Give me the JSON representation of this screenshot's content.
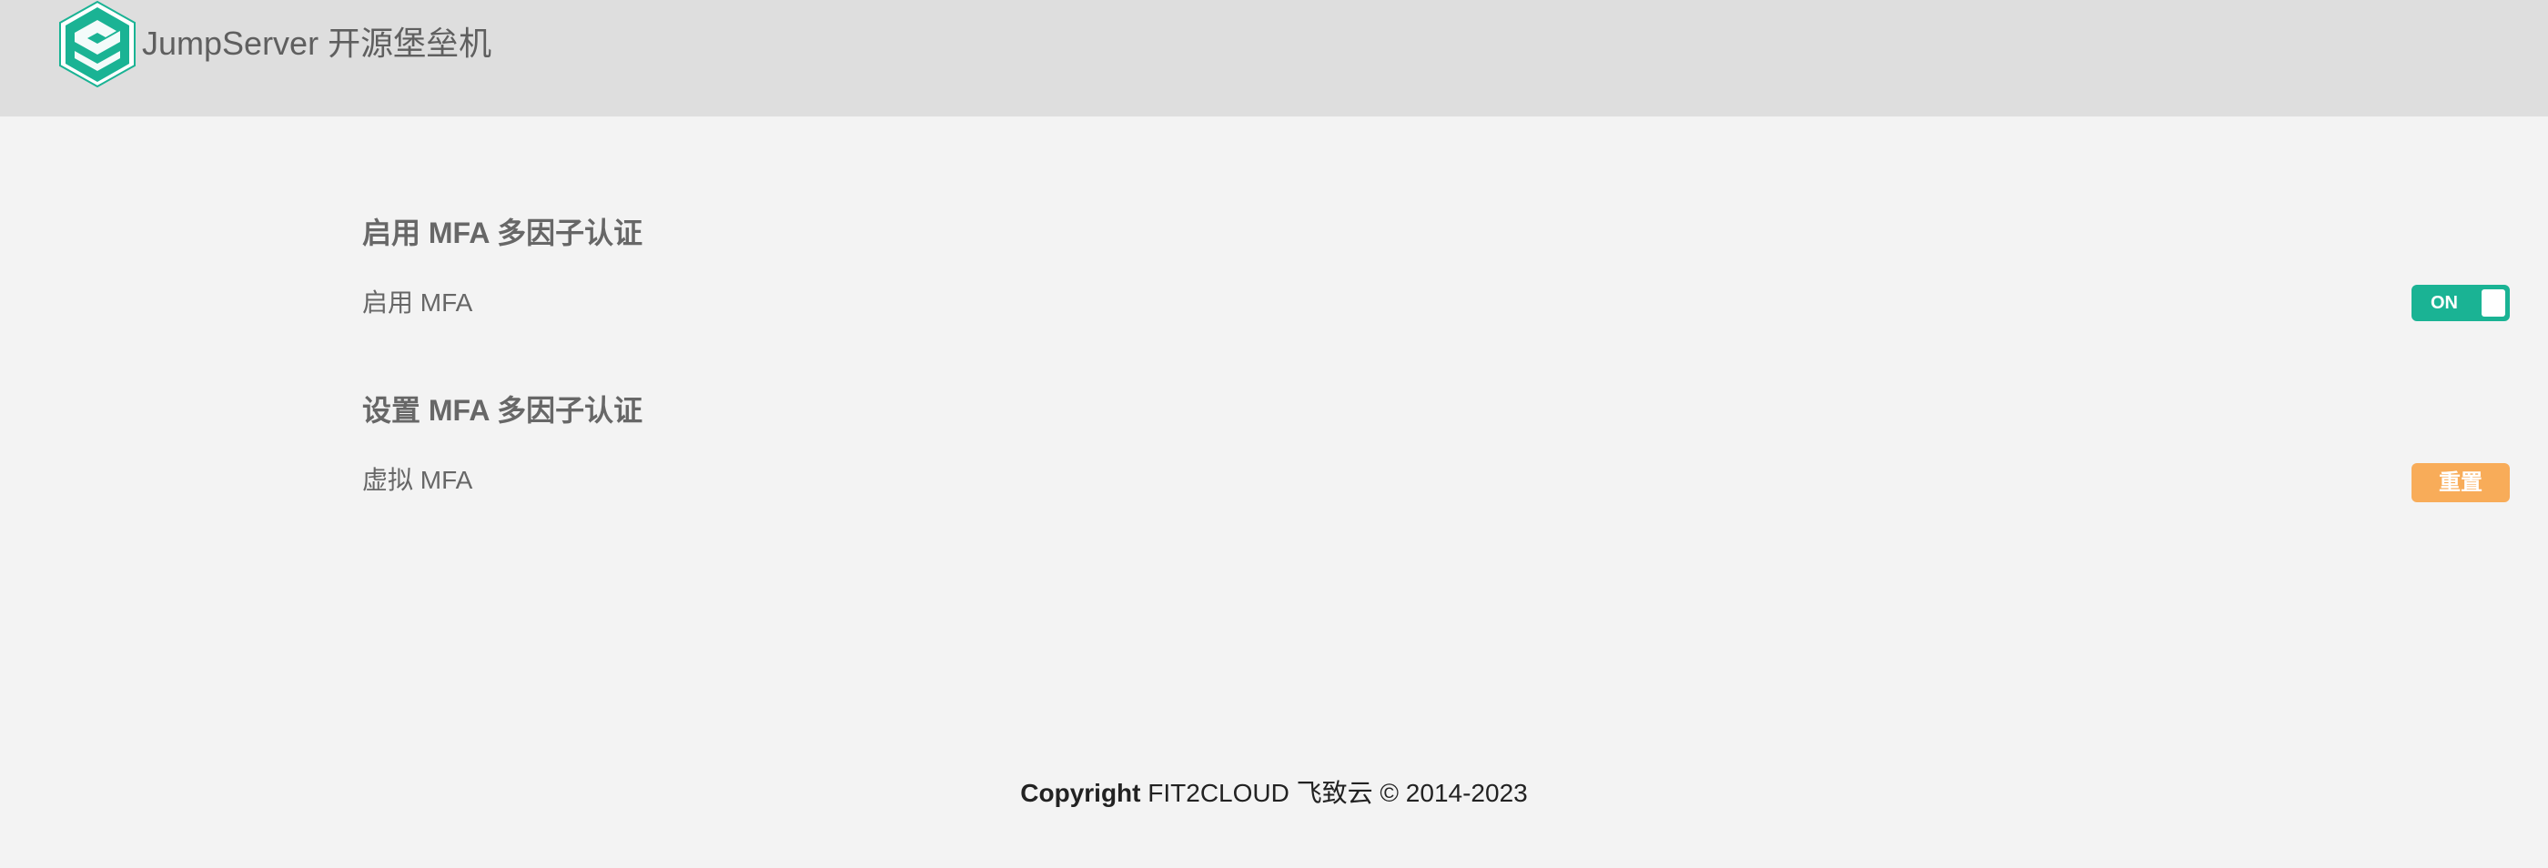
{
  "header": {
    "brand": "JumpServer 开源堡垒机",
    "logo_icon": "jumpserver-logo-icon",
    "logo_color": "#1ab394"
  },
  "sections": [
    {
      "title": "启用 MFA 多因子认证",
      "row_label": "启用 MFA",
      "control": {
        "type": "toggle",
        "label": "ON",
        "state": "on",
        "color": "#1ab394"
      }
    },
    {
      "title": "设置 MFA 多因子认证",
      "row_label": "虚拟 MFA",
      "control": {
        "type": "button",
        "label": "重置",
        "color": "#f8ac59"
      }
    }
  ],
  "footer": {
    "copyright_label": "Copyright",
    "text": " FIT2CLOUD 飞致云 © 2014-2023"
  }
}
